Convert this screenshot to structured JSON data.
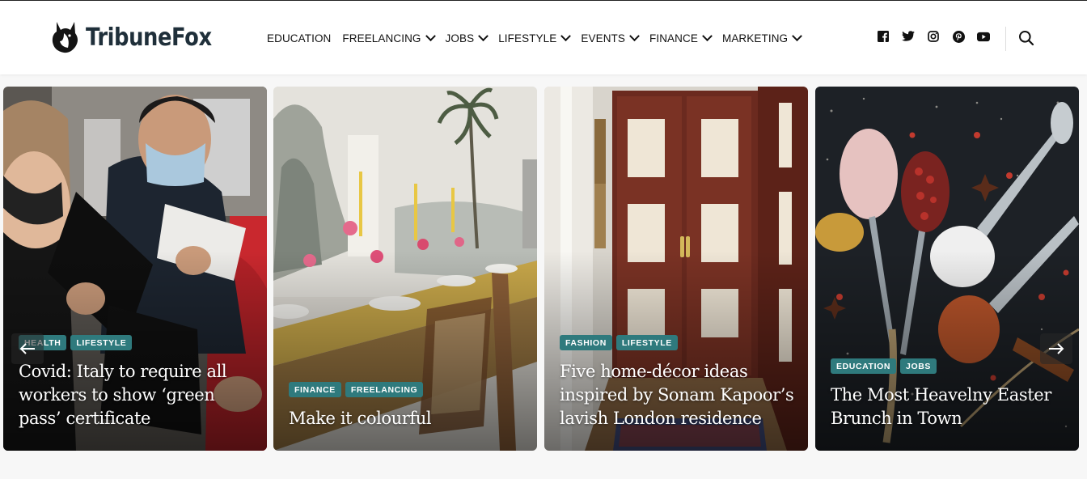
{
  "brand": {
    "name_part1": "Tribune",
    "name_part2": "Fox"
  },
  "nav": [
    {
      "label": "EDUCATION",
      "has_dropdown": false
    },
    {
      "label": "FREELANCING",
      "has_dropdown": true
    },
    {
      "label": "JOBS",
      "has_dropdown": true
    },
    {
      "label": "LIFESTYLE",
      "has_dropdown": true
    },
    {
      "label": "EVENTS",
      "has_dropdown": true
    },
    {
      "label": "FINANCE",
      "has_dropdown": true
    },
    {
      "label": "MARKETING",
      "has_dropdown": true
    }
  ],
  "social_icons": [
    "facebook-icon",
    "twitter-icon",
    "instagram-icon",
    "pinterest-icon",
    "youtube-icon"
  ],
  "search_icon": "search-icon",
  "accent_color": "#2f7a7d",
  "slider": {
    "prev_icon": "arrow-left-icon",
    "next_icon": "arrow-right-icon",
    "cards": [
      {
        "categories": [
          "HEALTH",
          "LIFESTYLE"
        ],
        "title": "Covid: Italy to require all workers to show ‘green pass’ certificate"
      },
      {
        "categories": [
          "FINANCE",
          "FREELANCING"
        ],
        "title": "Make it colourful"
      },
      {
        "categories": [
          "FASHION",
          "LIFESTYLE"
        ],
        "title": "Five home-décor ideas inspired by Sonam Kapoor’s lavish London residence"
      },
      {
        "categories": [
          "EDUCATION",
          "JOBS"
        ],
        "title": "The Most Heavelny Easter Brunch in Town"
      }
    ]
  }
}
